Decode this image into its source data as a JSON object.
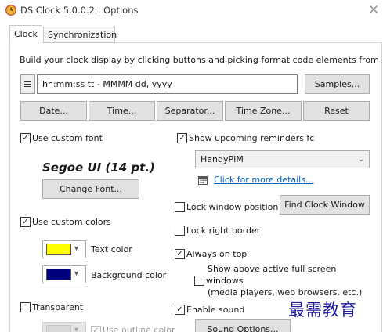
{
  "window": {
    "title": "DS Clock 5.0.0.2 : Options",
    "close_glyph": "✕"
  },
  "tabs": [
    {
      "label": "Clock"
    },
    {
      "label": "Synchronization"
    }
  ],
  "clock": {
    "instructions": "Build your clock display by clicking buttons and picking format code elements from",
    "format_value": "hh:mm:ss tt - MMMM dd, yyyy",
    "samples_label": "Samples...",
    "buttons": {
      "date": "Date...",
      "time": "Time...",
      "separator": "Separator...",
      "timezone": "Time Zone...",
      "reset": "Reset"
    },
    "use_custom_font": {
      "label": "Use custom font",
      "checked": true
    },
    "font_preview": "Segoe UI (14 pt.)",
    "change_font_label": "Change Font...",
    "use_custom_colors": {
      "label": "Use custom colors",
      "checked": true
    },
    "text_color": {
      "label": "Text color",
      "color": "#ffff00"
    },
    "background_color": {
      "label": "Background color",
      "color": "#00007f"
    },
    "transparent": {
      "label": "Transparent",
      "checked": false
    },
    "use_outline_color": {
      "label": "Use outline color",
      "checked": true,
      "enabled": false
    },
    "show_reminders": {
      "label": "Show upcoming reminders fc",
      "checked": true
    },
    "reminders_source": "HandyPIM",
    "more_details_link": "Click for more details...",
    "lock_window_position": {
      "label": "Lock window position",
      "checked": false
    },
    "find_clock_window_label": "Find Clock Window",
    "lock_right_border": {
      "label": "Lock right border",
      "checked": false
    },
    "always_on_top": {
      "label": "Always on top",
      "checked": true
    },
    "show_above_fullscreen": {
      "line1": "Show above active full screen",
      "line2": "windows",
      "line3": "(media players, web browsers, etc.)",
      "checked": false
    },
    "enable_sound": {
      "label": "Enable sound",
      "checked": true
    },
    "sound_options_label": "Sound Options..."
  },
  "watermark": "最需教育",
  "colors": {
    "accent_link": "#0066cc",
    "title_icon": "#e8a21a"
  }
}
